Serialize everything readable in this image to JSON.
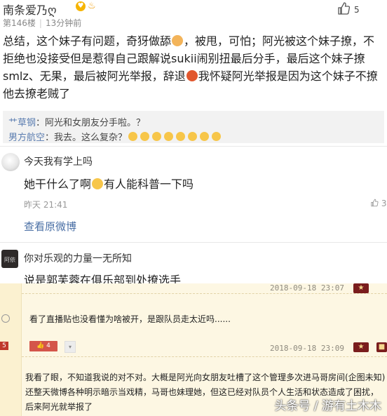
{
  "header": {
    "username": "南条爱乃ღ",
    "like_count": "5"
  },
  "meta": {
    "floor": "第146楼",
    "time": "13分钟前"
  },
  "post": {
    "part1": "总结，这个妹子有问题，奇犽做舔",
    "part2": "，被甩，可怕；阿光被这个妹子撩，不拒绝也没接受但是惹得自己跟解说sukii闹别扭最后分手，最后这个妹子撩smlz、无果，最后被阿光举报，辞退",
    "part3": "我怀疑阿光举报是因为这个妹子不撩他去撩老贼了"
  },
  "replies": [
    {
      "name": "艹草钢",
      "text": "：阿光和女朋友分手啦。？"
    },
    {
      "name": "男方航空",
      "text": "：我去。这么复杂？"
    }
  ],
  "comment1": {
    "title": "今天我有学上吗",
    "text_a": "她干什么了啊",
    "text_b": "有人能科普一下吗",
    "time": "昨天 21:41",
    "likes": "3",
    "view_link": "查看原微博"
  },
  "comment2": {
    "title": "你对乐观的力量一无所知",
    "text": "说是郭芙蓉在俱乐部到处撩选手",
    "avatar_text": "阿依"
  },
  "forum": {
    "date1": "2018-09-18 23:07",
    "post1": "看了直播贴也没看懂为啥被开，是跟队员走太近吗......",
    "vote": "4",
    "date2": "2018-09-18 23:09",
    "side_num": "5",
    "post2": "我看了眼，不知道我说的对不对。大概是阿光向女朋友吐槽了这个管理多次进马哥房间(企图未知)还整天微博各种明示暗示当戏精，马哥也妹理她，但这已经对队员个人生活和状态造成了困扰，后来阿光就举报了"
  },
  "watermark": "头条号 / 游有土木木",
  "icons": {
    "like": "thumb-up-icon",
    "badge1": "vip-badge-icon",
    "badge2": "fire-badge-icon"
  }
}
